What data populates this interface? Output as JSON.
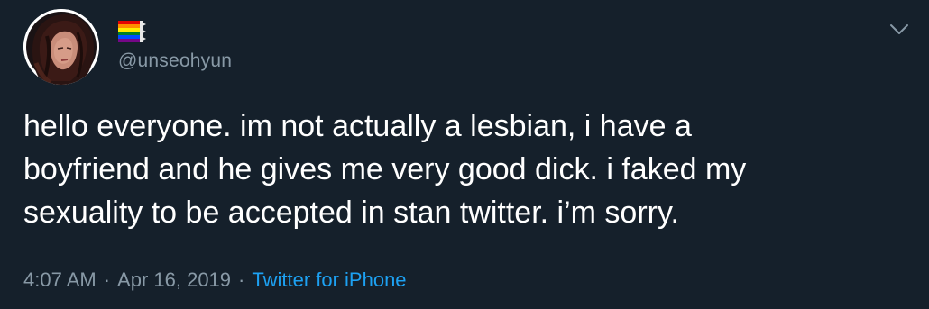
{
  "tweet": {
    "display_name_icon": "rainbow-flag-icon",
    "handle": "@unseohyun",
    "text": "hello everyone. im not actually a lesbian, i have a\nboyfriend and he gives me very good dick. i faked my\nsexuality to be accepted in stan twitter. i’m sorry.",
    "time": "4:07 AM",
    "separator": "·",
    "date": "Apr 16, 2019",
    "source": "Twitter for iPhone",
    "menu_icon": "chevron-down-icon"
  },
  "colors": {
    "background": "#15202b",
    "text": "#ffffff",
    "secondary": "#8899a6",
    "link": "#1da1f2"
  }
}
